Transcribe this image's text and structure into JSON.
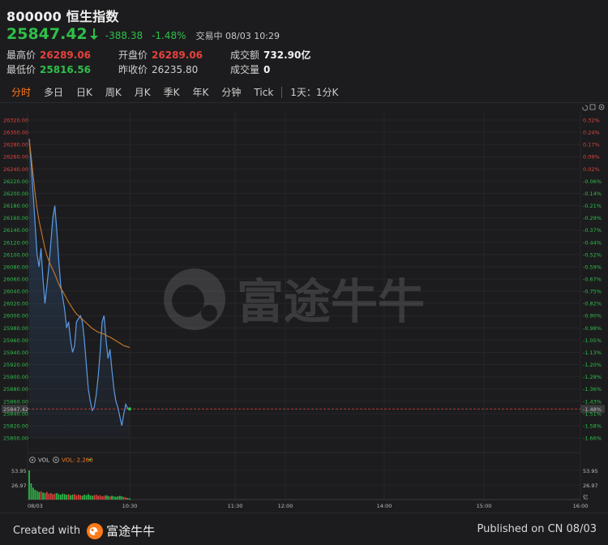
{
  "header": {
    "title": "800000 恒生指数",
    "price": "25847.42",
    "change": "-388.38",
    "change_pct": "-1.48%",
    "status": "交易中 08/03 10:29",
    "stats": {
      "high_label": "最高价",
      "high": "26289.06",
      "low_label": "最低价",
      "low": "25816.56",
      "open_label": "开盘价",
      "open": "26289.06",
      "prev_close_label": "昨收价",
      "prev_close": "26235.80",
      "turnover_label": "成交额",
      "turnover": "732.90亿",
      "volume_label": "成交量",
      "volume": "0"
    }
  },
  "tabs": [
    "分时",
    "多日",
    "日K",
    "周K",
    "月K",
    "季K",
    "年K",
    "分钟",
    "Tick",
    "1天：1分K"
  ],
  "indicator": {
    "vol_label": "VOL",
    "vol_value": "VOL: 2.260"
  },
  "watermark": "富途牛牛",
  "footer": {
    "created_with": "Created with",
    "brand": "富途牛牛",
    "published": "Published on CN 08/03"
  },
  "colors": {
    "up": "#e5423d",
    "down": "#2fbf4a",
    "accent": "#ff7a1a",
    "line": "#5b9be8",
    "avg": "#c97a2a"
  },
  "chart_data": {
    "type": "line",
    "y_left_ticks": [
      "26320.00",
      "26300.00",
      "26280.00",
      "26260.00",
      "26240.00",
      "26220.00",
      "26200.00",
      "26180.00",
      "26160.00",
      "26140.00",
      "26120.00",
      "26100.00",
      "26080.00",
      "26060.00",
      "26040.00",
      "26020.00",
      "26000.00",
      "25980.00",
      "25960.00",
      "25940.00",
      "25920.00",
      "25900.00",
      "25880.00",
      "25860.00",
      "25840.00",
      "25820.00",
      "25800.00"
    ],
    "y_right_ticks": [
      "0.32%",
      "0.24%",
      "0.17%",
      "0.09%",
      "0.02%",
      "-0.06%",
      "-0.14%",
      "-0.21%",
      "-0.29%",
      "-0.37%",
      "-0.44%",
      "-0.52%",
      "-0.59%",
      "-0.67%",
      "-0.75%",
      "-0.82%",
      "-0.90%",
      "-0.98%",
      "-1.05%",
      "-1.13%",
      "-1.20%",
      "-1.28%",
      "-1.36%",
      "-1.43%",
      "-1.51%",
      "-1.58%",
      "-1.66%"
    ],
    "ylim": [
      25800,
      26320
    ],
    "x_ticks": [
      "08/03",
      "10:30",
      "11:30",
      "12:00",
      "14:00",
      "15:00",
      "16:00"
    ],
    "current_price_label": "25847.42",
    "current_pct_label": "-1.48%",
    "price_series": [
      26289.06,
      26250,
      26200,
      26150,
      26100,
      26080,
      26110,
      26060,
      26020,
      26050,
      26080,
      26120,
      26160,
      26180,
      26140,
      26090,
      26050,
      26030,
      26010,
      25980,
      25990,
      25960,
      25940,
      25950,
      25990,
      25995,
      26000,
      25990,
      25960,
      25920,
      25880,
      25860,
      25845,
      25850,
      25870,
      25900,
      25940,
      25990,
      26000,
      25960,
      25930,
      25945,
      25910,
      25880,
      25860,
      25850,
      25835,
      25820,
      25840,
      25855,
      25848,
      25847.42
    ],
    "avg_series": [
      26289.06,
      26260,
      26230,
      26200,
      26175,
      26155,
      26140,
      26125,
      26110,
      26098,
      26090,
      26082,
      26075,
      26068,
      26060,
      26052,
      26045,
      26040,
      26034,
      26028,
      26022,
      26017,
      26012,
      26007,
      26003,
      26000,
      25997,
      25994,
      25991,
      25988,
      25985,
      25982,
      25979,
      25977,
      25975,
      25973,
      25972,
      25971,
      25970,
      25968,
      25966,
      25965,
      25963,
      25961,
      25959,
      25957,
      25955,
      25953,
      25951,
      25950,
      25949,
      25948
    ],
    "volume_ticks": [
      "53.95",
      "26.97",
      "亿"
    ],
    "volume_series": [
      53.95,
      30,
      22,
      18,
      16,
      14,
      15,
      13,
      12,
      14,
      11,
      12,
      10,
      11,
      12,
      10,
      9,
      11,
      10,
      9,
      10,
      8,
      9,
      10,
      8,
      9,
      8,
      7,
      9,
      8,
      10,
      8,
      7,
      8,
      9,
      7,
      8,
      6,
      7,
      8,
      7,
      6,
      7,
      6,
      5,
      6,
      7,
      6,
      5,
      4,
      3,
      2.3
    ]
  }
}
